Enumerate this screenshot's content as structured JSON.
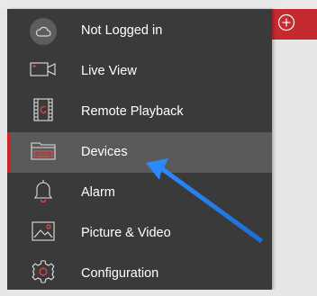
{
  "menu": {
    "items": [
      {
        "label": "Not Logged in",
        "icon": "cloud-icon"
      },
      {
        "label": "Live View",
        "icon": "camera-icon"
      },
      {
        "label": "Remote Playback",
        "icon": "film-playback-icon"
      },
      {
        "label": "Devices",
        "icon": "folder-icon",
        "selected": true
      },
      {
        "label": "Alarm",
        "icon": "bell-icon"
      },
      {
        "label": "Picture & Video",
        "icon": "picture-icon"
      },
      {
        "label": "Configuration",
        "icon": "gear-icon"
      }
    ]
  },
  "header": {
    "add_icon": "plus-circle-icon"
  },
  "colors": {
    "drawer_bg": "#3a3a3a",
    "selected_bg": "#5a5a5a",
    "accent_red": "#c62828",
    "icon_red": "#e84a4a",
    "arrow_blue": "#1e7df0"
  }
}
